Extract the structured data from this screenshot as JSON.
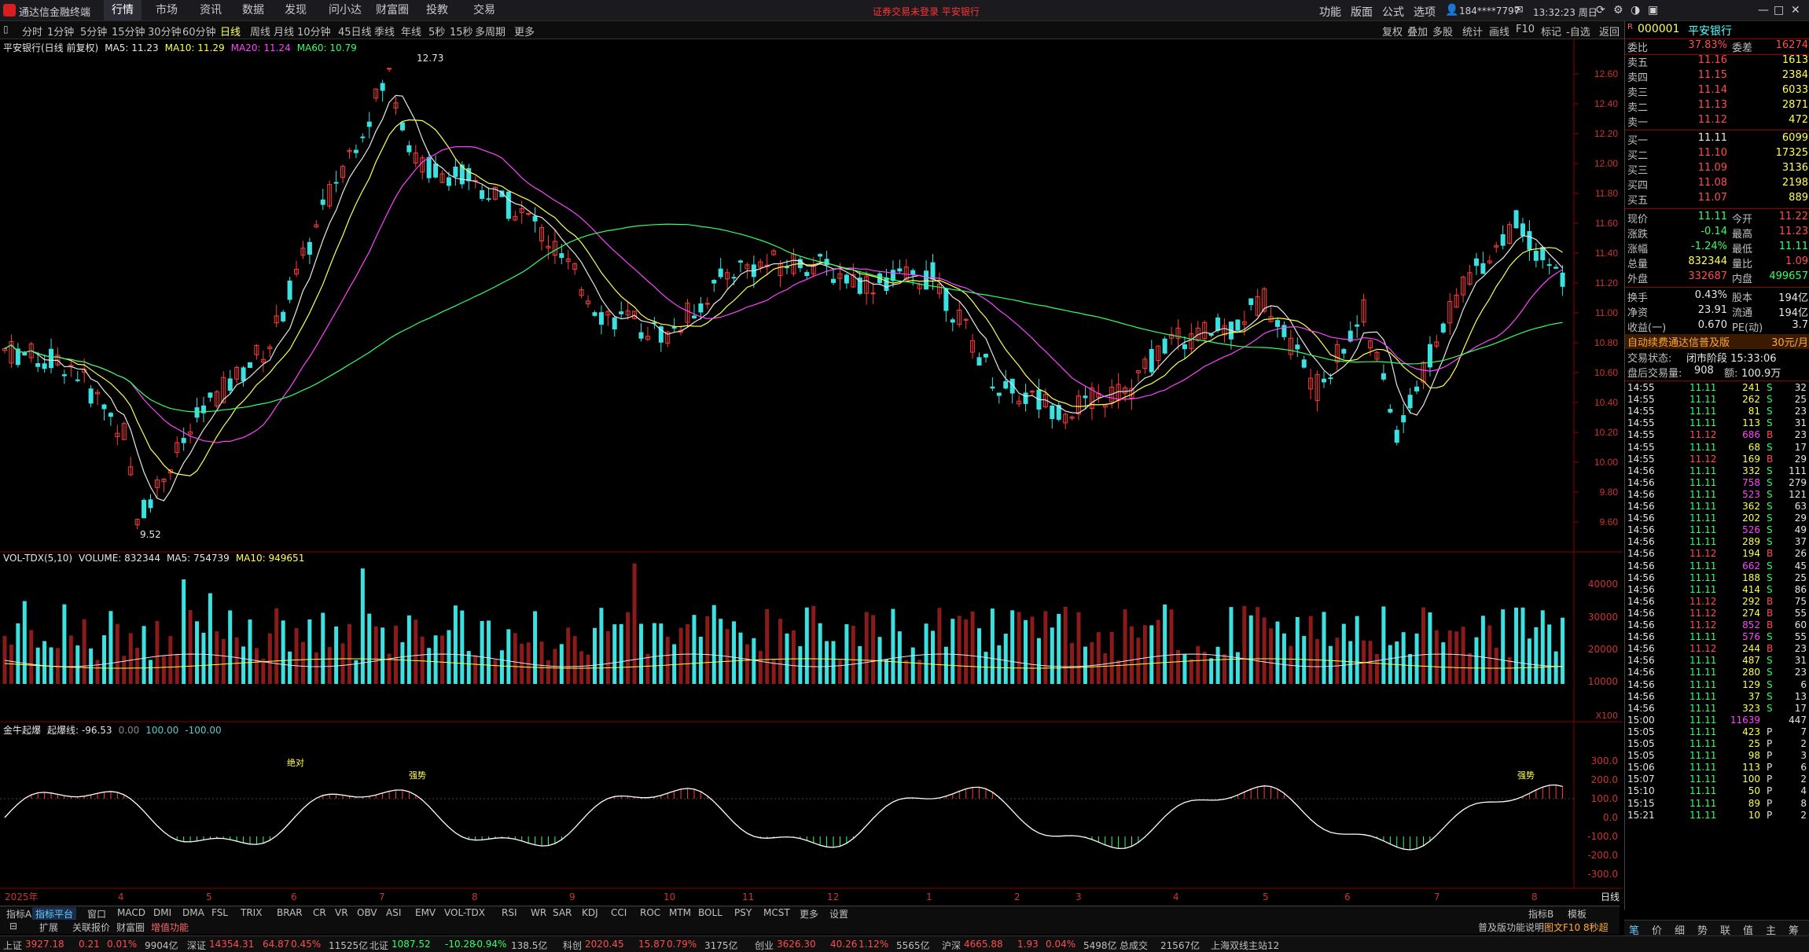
{
  "app": {
    "name": "通达信金融终端",
    "notice": "证券交易未登录  平安银行"
  },
  "topnav": [
    "行情",
    "市场",
    "资讯",
    "数据",
    "发现",
    "问小达",
    "财富圈",
    "投教",
    "交易"
  ],
  "topnav_active": 0,
  "sysmenu": [
    "功能",
    "版面",
    "公式",
    "选项"
  ],
  "user": "184****7797",
  "clock": "13:32:23 周日",
  "periods": [
    "分时",
    "1分钟",
    "5分钟",
    "15分钟",
    "30分钟",
    "60分钟",
    "日线",
    "周线",
    "月线",
    "10分钟",
    "45日线",
    "季线",
    "年线",
    "5秒",
    "15秒",
    "多周期",
    "更多"
  ],
  "period_active": 6,
  "right_tools": [
    "复权",
    "叠加",
    "多股",
    "统计",
    "画线",
    "F10",
    "标记",
    "-自选",
    "返回"
  ],
  "main_chart": {
    "title": "平安银行(日线 前复权)",
    "ma": [
      {
        "label": "MA5: 11.23",
        "color": "#e6e6e6"
      },
      {
        "label": "MA10: 11.29",
        "color": "#ffff55"
      },
      {
        "label": "MA20: 11.24",
        "color": "#ff44ff"
      },
      {
        "label": "MA60: 10.79",
        "color": "#33ff66"
      }
    ],
    "price_labels": [
      "12.60",
      "12.40",
      "12.20",
      "12.00",
      "11.80",
      "11.60",
      "11.40",
      "11.20",
      "11.00",
      "10.80",
      "10.60",
      "10.40",
      "10.20",
      "10.00",
      "9.80",
      "9.60"
    ],
    "high_label": "12.73",
    "low_label": "9.52"
  },
  "volume_chart": {
    "title": "VOL-TDX(5,10)",
    "items": [
      {
        "label": "VOLUME: 832344",
        "color": "#e6e6e6"
      },
      {
        "label": "MA5: 754739",
        "color": "#e6e6e6"
      },
      {
        "label": "MA10: 949651",
        "color": "#ffff55"
      }
    ],
    "axis": [
      "40000",
      "30000",
      "20000",
      "10000"
    ],
    "unit": "X100"
  },
  "indicator_chart": {
    "title": "金牛起爆",
    "items": [
      {
        "label": "起爆线: -96.53",
        "color": "#e6e6e6"
      },
      {
        "label": "0.00",
        "color": "#888888"
      },
      {
        "label": "100.00",
        "color": "#55cccc"
      },
      {
        "label": "-100.00",
        "color": "#55cccc"
      }
    ],
    "axis": [
      "300.0",
      "200.0",
      "100.0",
      "0.0",
      "-100.0",
      "-200.0",
      "-300.0"
    ],
    "markers": [
      "绝对",
      "强势",
      "强势",
      "强势"
    ]
  },
  "date_axis": [
    "2025年",
    "4",
    "5",
    "6",
    "7",
    "8",
    "9",
    "10",
    "11",
    "12",
    "1",
    "2",
    "3",
    "4",
    "5",
    "6",
    "7",
    "8"
  ],
  "period_label": "日线",
  "bottom_tabs": [
    "指标A",
    "指标平台",
    "窗口",
    "MACD",
    "DMI",
    "DMA",
    "FSL",
    "TRIX",
    "BRAR",
    "CR",
    "VR",
    "OBV",
    "ASI",
    "EMV",
    "VOL-TDX",
    "RSI",
    "WR",
    "SAR",
    "KDJ",
    "CCI",
    "ROC",
    "MTM",
    "BOLL",
    "PSY",
    "MCST",
    "更多",
    "设置"
  ],
  "bottom_tabs_right": [
    "指标B",
    "模板"
  ],
  "bottom_tabs2": [
    "扩展",
    "关联报价",
    "财富圈",
    "增值功能"
  ],
  "bottom_right_text": [
    "普及版功能说明",
    "图文F10 8秒超延"
  ],
  "ticker": [
    {
      "name": "上证",
      "val": "3927.18",
      "chg": "0.21",
      "pct": "0.01%",
      "amt": "9904亿"
    },
    {
      "name": "深证",
      "val": "14354.31",
      "chg": "64.87",
      "pct": "0.45%",
      "amt": "11525亿"
    },
    {
      "name": "北证",
      "val": "1087.52",
      "chg": "-10.28",
      "pct": "-0.94%",
      "amt": "138.5亿"
    },
    {
      "name": "科创",
      "val": "2020.45",
      "chg": "15.87",
      "pct": "0.79%",
      "amt": "3175亿"
    },
    {
      "name": "创业",
      "val": "3626.30",
      "chg": "40.26",
      "pct": "1.12%",
      "amt": "5565亿"
    },
    {
      "name": "沪深",
      "val": "4665.88",
      "chg": "1.93",
      "pct": "0.04%",
      "amt": "5498亿"
    }
  ],
  "ticker_total": {
    "label": "总成交",
    "val": "21567亿"
  },
  "ticker_server": "上海双线主站12",
  "stock": {
    "code": "000001",
    "name": "平安银行"
  },
  "weibi": {
    "l1": "委比",
    "v1": "37.83%",
    "l2": "委差",
    "v2": "16274"
  },
  "sells": [
    {
      "l": "卖五",
      "p": "11.16",
      "v": "1613"
    },
    {
      "l": "卖四",
      "p": "11.15",
      "v": "2384"
    },
    {
      "l": "卖三",
      "p": "11.14",
      "v": "6033"
    },
    {
      "l": "卖二",
      "p": "11.13",
      "v": "2871"
    },
    {
      "l": "卖一",
      "p": "11.12",
      "v": "472"
    }
  ],
  "buys": [
    {
      "l": "买一",
      "p": "11.11",
      "v": "6099"
    },
    {
      "l": "买二",
      "p": "11.10",
      "v": "17325"
    },
    {
      "l": "买三",
      "p": "11.09",
      "v": "3136"
    },
    {
      "l": "买四",
      "p": "11.08",
      "v": "2198"
    },
    {
      "l": "买五",
      "p": "11.07",
      "v": "889"
    }
  ],
  "quote": [
    {
      "l1": "现价",
      "v1": "11.11",
      "c1": "green",
      "l2": "今开",
      "v2": "11.22",
      "c2": "red"
    },
    {
      "l1": "涨跌",
      "v1": "-0.14",
      "c1": "green",
      "l2": "最高",
      "v2": "11.23",
      "c2": "red"
    },
    {
      "l1": "涨幅",
      "v1": "-1.24%",
      "c1": "green",
      "l2": "最低",
      "v2": "11.11",
      "c2": "green"
    },
    {
      "l1": "总量",
      "v1": "832344",
      "c1": "yellow",
      "l2": "量比",
      "v2": "1.09",
      "c2": "red"
    },
    {
      "l1": "外盘",
      "v1": "332687",
      "c1": "red",
      "l2": "内盘",
      "v2": "499657",
      "c2": "green"
    }
  ],
  "quote2": [
    {
      "l1": "换手",
      "v1": "0.43%",
      "l2": "股本",
      "v2": "194亿"
    },
    {
      "l1": "净资",
      "v1": "23.91",
      "l2": "流通",
      "v2": "194亿"
    },
    {
      "l1": "收益(一)",
      "v1": "0.670",
      "l2": "PE(动)",
      "v2": "3.7"
    }
  ],
  "promo": {
    "text": "自动续费通达信普及版",
    "price": "30元/月"
  },
  "trade_status": {
    "l1": "交易状态:",
    "v1": "闭市阶段 15:33:06",
    "l2": "盘后交易量:",
    "v2": "908",
    "l3": "额:",
    "v3": "100.9万"
  },
  "ticks": [
    [
      "14:55",
      "11.11",
      "241",
      "S",
      "32"
    ],
    [
      "14:55",
      "11.11",
      "262",
      "S",
      "25"
    ],
    [
      "14:55",
      "11.11",
      "81",
      "S",
      "23"
    ],
    [
      "14:55",
      "11.11",
      "113",
      "S",
      "31"
    ],
    [
      "14:55",
      "11.12",
      "686",
      "B",
      "23"
    ],
    [
      "14:55",
      "11.11",
      "68",
      "S",
      "17"
    ],
    [
      "14:55",
      "11.12",
      "169",
      "B",
      "29"
    ],
    [
      "14:56",
      "11.11",
      "332",
      "S",
      "111"
    ],
    [
      "14:56",
      "11.11",
      "758",
      "S",
      "279"
    ],
    [
      "14:56",
      "11.11",
      "523",
      "S",
      "121"
    ],
    [
      "14:56",
      "11.11",
      "362",
      "S",
      "63"
    ],
    [
      "14:56",
      "11.11",
      "202",
      "S",
      "29"
    ],
    [
      "14:56",
      "11.11",
      "526",
      "S",
      "49"
    ],
    [
      "14:56",
      "11.11",
      "289",
      "S",
      "37"
    ],
    [
      "14:56",
      "11.12",
      "194",
      "B",
      "26"
    ],
    [
      "14:56",
      "11.11",
      "662",
      "S",
      "45"
    ],
    [
      "14:56",
      "11.11",
      "188",
      "S",
      "25"
    ],
    [
      "14:56",
      "11.11",
      "414",
      "S",
      "86"
    ],
    [
      "14:56",
      "11.12",
      "292",
      "B",
      "75"
    ],
    [
      "14:56",
      "11.12",
      "274",
      "B",
      "55"
    ],
    [
      "14:56",
      "11.12",
      "852",
      "B",
      "60"
    ],
    [
      "14:56",
      "11.11",
      "576",
      "S",
      "55"
    ],
    [
      "14:56",
      "11.12",
      "244",
      "B",
      "23"
    ],
    [
      "14:56",
      "11.11",
      "487",
      "S",
      "31"
    ],
    [
      "14:56",
      "11.11",
      "280",
      "S",
      "23"
    ],
    [
      "14:56",
      "11.11",
      "129",
      "S",
      "6"
    ],
    [
      "14:56",
      "11.11",
      "37",
      "S",
      "13"
    ],
    [
      "14:56",
      "11.11",
      "323",
      "S",
      "17"
    ],
    [
      "15:00",
      "11.11",
      "11639",
      "",
      "447"
    ],
    [
      "15:05",
      "11.11",
      "423",
      "P",
      "7"
    ],
    [
      "15:05",
      "11.11",
      "25",
      "P",
      "2"
    ],
    [
      "15:05",
      "11.11",
      "98",
      "P",
      "3"
    ],
    [
      "15:06",
      "11.11",
      "113",
      "P",
      "6"
    ],
    [
      "15:07",
      "11.11",
      "100",
      "P",
      "2"
    ],
    [
      "15:10",
      "11.11",
      "50",
      "P",
      "4"
    ],
    [
      "15:15",
      "11.11",
      "89",
      "P",
      "8"
    ],
    [
      "15:21",
      "11.11",
      "10",
      "P",
      "2"
    ]
  ],
  "rbottom": [
    "笔",
    "价",
    "细",
    "势",
    "联",
    "值",
    "主",
    "筹"
  ]
}
